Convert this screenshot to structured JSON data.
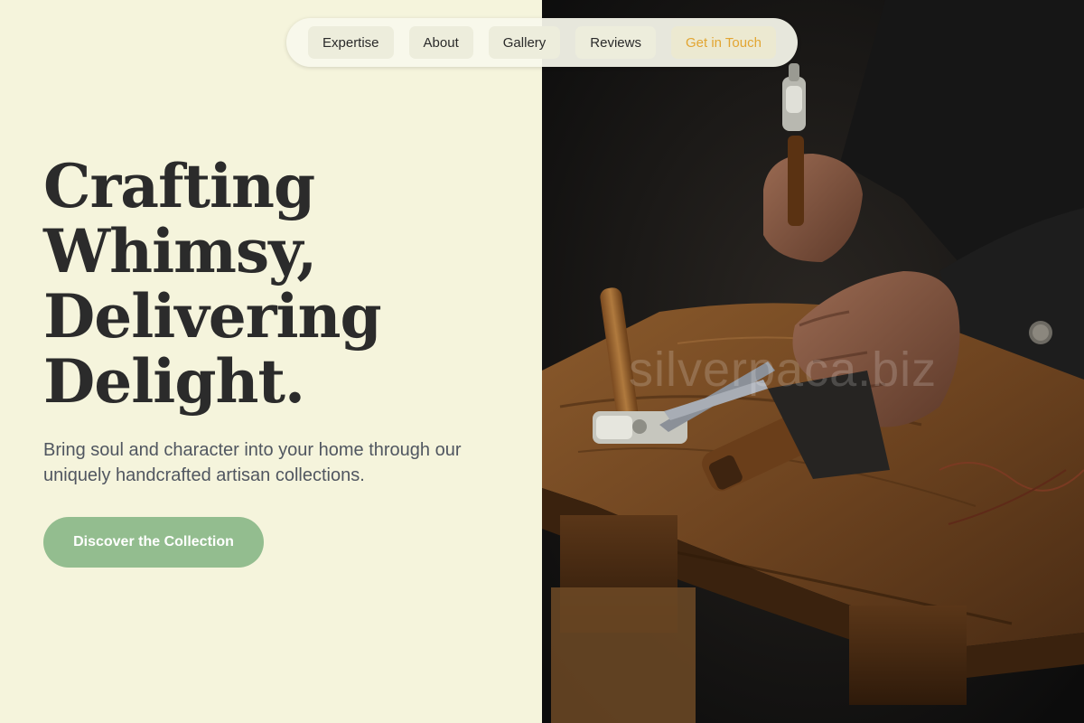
{
  "nav": {
    "items": [
      {
        "label": "Expertise"
      },
      {
        "label": "About"
      },
      {
        "label": "Gallery"
      },
      {
        "label": "Reviews"
      },
      {
        "label": "Get in Touch"
      }
    ],
    "accent_color": "#e2a532"
  },
  "hero": {
    "title_lines": [
      "Crafting",
      "Whimsy,",
      "Delivering",
      "Delight."
    ],
    "subtitle": "Bring soul and character into your home through our uniquely handcrafted artisan collections.",
    "cta_label": "Discover the Collection"
  },
  "photo": {
    "watermark": "silverpaca.biz"
  },
  "colors": {
    "background": "#f5f4dc",
    "cta": "#93bd8f",
    "title": "#2b2b2b"
  }
}
